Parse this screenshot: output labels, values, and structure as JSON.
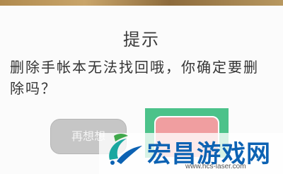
{
  "dialog": {
    "title": "提示",
    "message": "删除手帐本无法找回哦，你确定要删除吗？",
    "cancel_label": "再想想"
  },
  "watermark": {
    "brand": "宏昌游戏网",
    "url": "www.hcs-laser.com",
    "colors": {
      "blue": "#0c62b3",
      "teal": "#1aa7a0",
      "green": "#3fa84a"
    }
  },
  "colors": {
    "cancel_button": "#c6c6c6",
    "confirm_button": "#f09ea0",
    "confirm_border_green": "#4cc28a"
  }
}
